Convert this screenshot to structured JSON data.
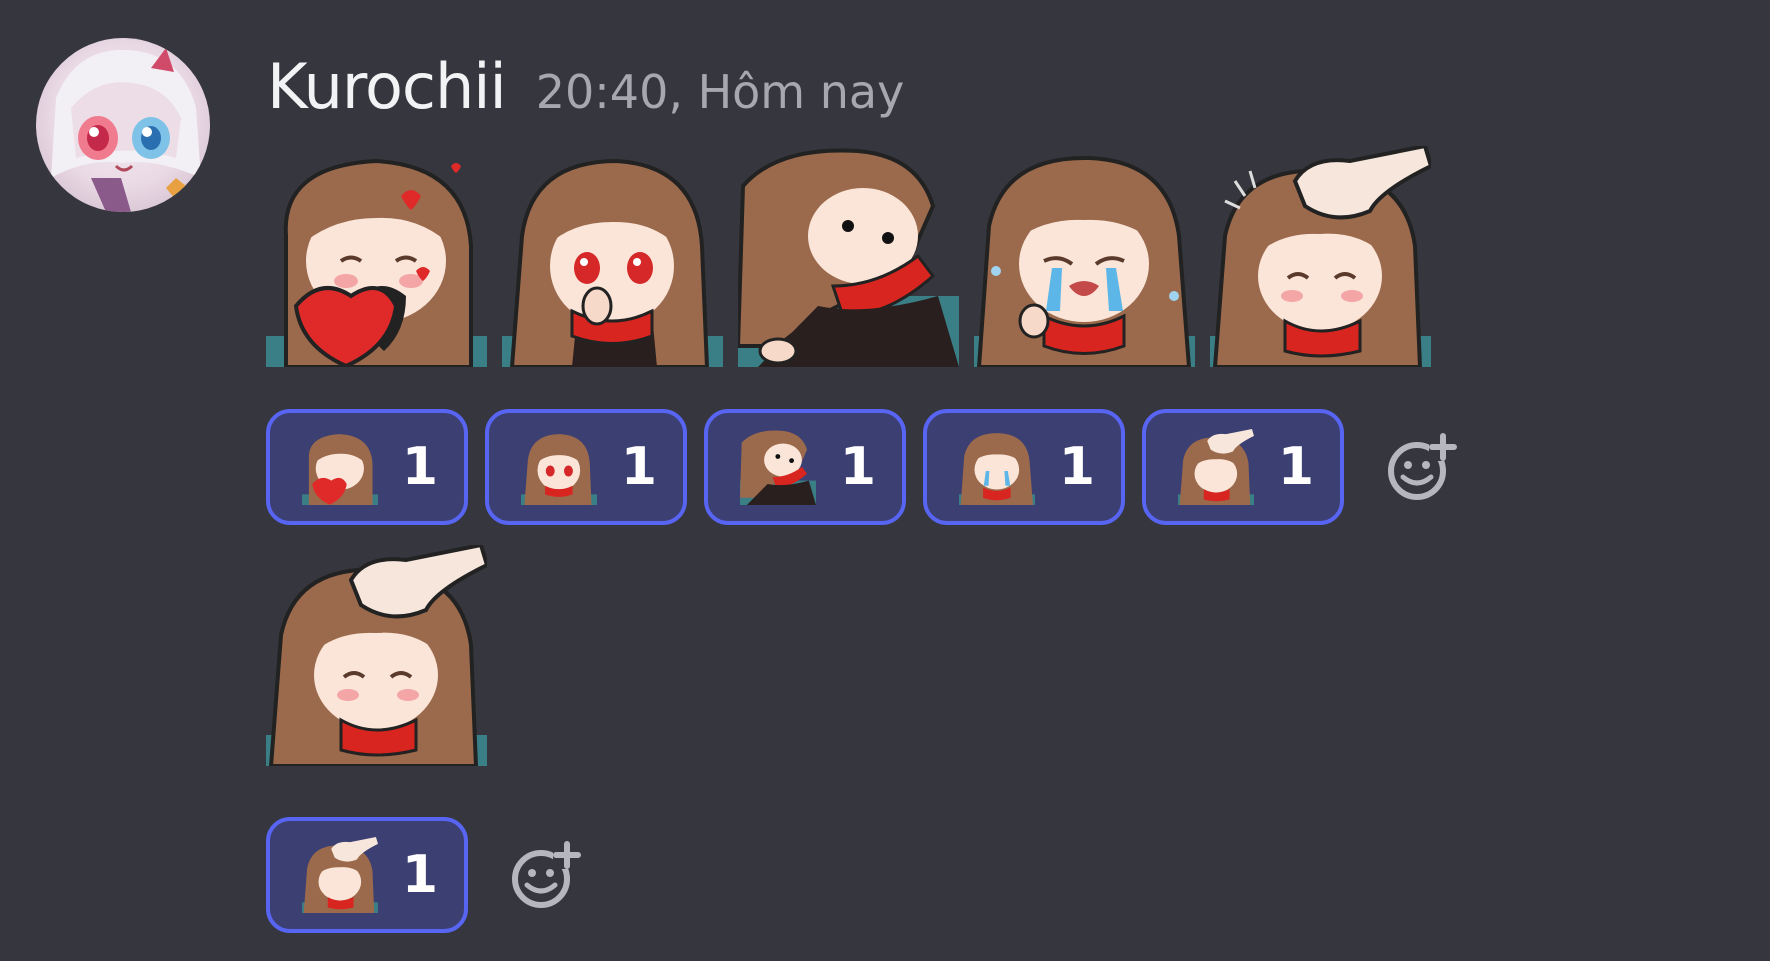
{
  "message": {
    "username": "Kurochii",
    "timestamp": "20:40, Hôm nay"
  },
  "stickers": [
    {
      "icon": "sticker-heart-hug"
    },
    {
      "icon": "sticker-red-eyes-hand"
    },
    {
      "icon": "sticker-dot-eyes-reach"
    },
    {
      "icon": "sticker-crying"
    },
    {
      "icon": "sticker-headpat"
    }
  ],
  "reactions_row1": [
    {
      "emoji": "sticker-heart-hug",
      "count": "1"
    },
    {
      "emoji": "sticker-red-eyes-hand",
      "count": "1"
    },
    {
      "emoji": "sticker-dot-eyes-reach",
      "count": "1"
    },
    {
      "emoji": "sticker-crying",
      "count": "1"
    },
    {
      "emoji": "sticker-headpat",
      "count": "1"
    }
  ],
  "second_sticker": {
    "icon": "sticker-headpat"
  },
  "reactions_row2": [
    {
      "emoji": "sticker-headpat",
      "count": "1"
    }
  ],
  "colors": {
    "background": "#36373e",
    "reaction_border": "#5865f2",
    "reaction_fill": "#3b3f72",
    "hair": "#9b6a4c",
    "scarf": "#d8251f"
  }
}
